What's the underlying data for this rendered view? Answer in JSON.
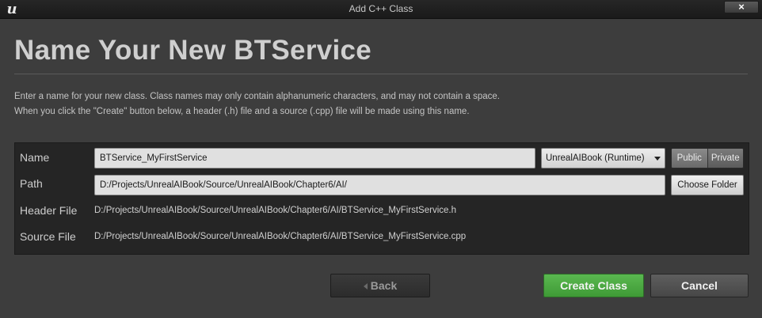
{
  "titlebar": {
    "title": "Add C++ Class",
    "close_label": "×",
    "logo_glyph": "u"
  },
  "heading": "Name Your New BTService",
  "description": {
    "line1": "Enter a name for your new class. Class names may only contain alphanumeric characters, and may not contain a space.",
    "line2": "When you click the \"Create\" button below, a header (.h) file and a source (.cpp) file will be made using this name."
  },
  "form": {
    "name_label": "Name",
    "name_value": "BTService_MyFirstService",
    "module_selected": "UnrealAIBook (Runtime)",
    "visibility_options": [
      "Public",
      "Private"
    ],
    "path_label": "Path",
    "path_value": "D:/Projects/UnrealAIBook/Source/UnrealAIBook/Chapter6/AI/",
    "choose_folder_label": "Choose Folder",
    "header_file_label": "Header File",
    "header_file_value": "D:/Projects/UnrealAIBook/Source/UnrealAIBook/Chapter6/AI/BTService_MyFirstService.h",
    "source_file_label": "Source File",
    "source_file_value": "D:/Projects/UnrealAIBook/Source/UnrealAIBook/Chapter6/AI/BTService_MyFirstService.cpp"
  },
  "buttons": {
    "back": "Back",
    "create": "Create Class",
    "cancel": "Cancel"
  },
  "colors": {
    "create_accent": "#4caf45",
    "background": "#3d3d3d",
    "panel": "#252525"
  }
}
